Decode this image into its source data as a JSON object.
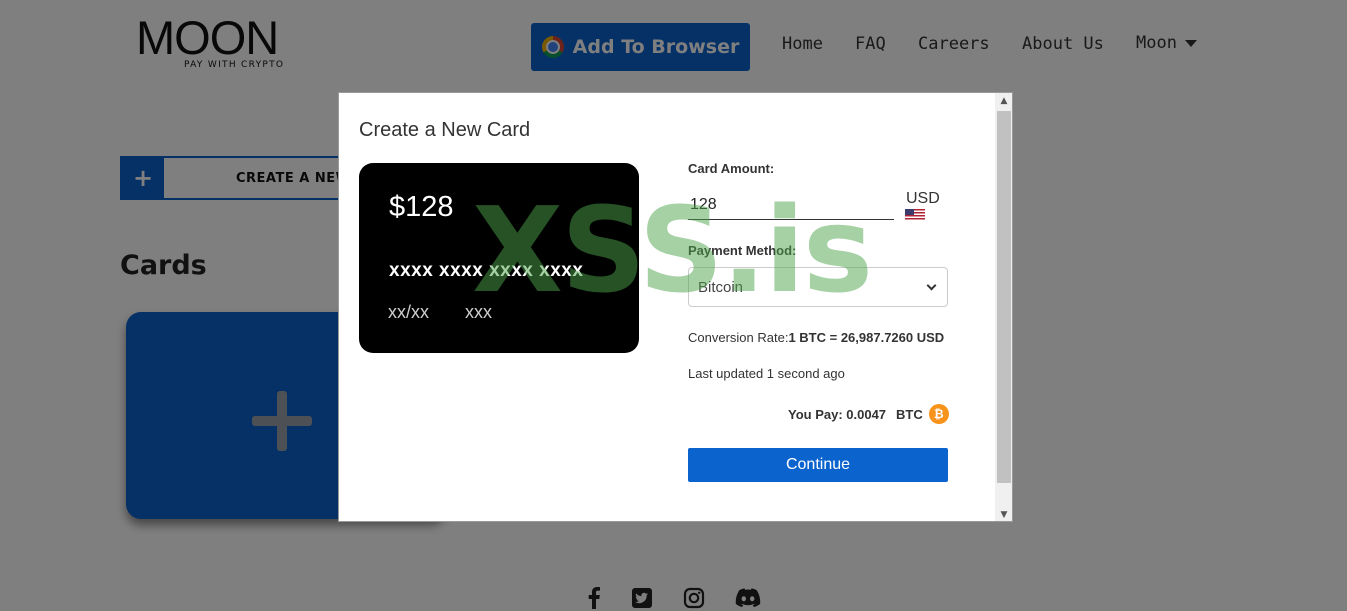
{
  "header": {
    "logo_text": "MOON",
    "logo_tagline": "PAY WITH CRYPTO",
    "add_to_browser_label": "Add To Browser",
    "nav": [
      {
        "label": "Home"
      },
      {
        "label": "FAQ"
      },
      {
        "label": "Careers"
      },
      {
        "label": "About Us"
      }
    ],
    "account_menu_label": "Moon"
  },
  "main": {
    "create_button_plus": "+",
    "create_button_label": "CREATE A NEW C",
    "cards_title": "Cards"
  },
  "footer": {
    "social_icons": [
      "facebook-icon",
      "twitter-icon",
      "instagram-icon",
      "discord-icon"
    ]
  },
  "modal": {
    "title": "Create a New Card",
    "card_preview": {
      "amount": "$128",
      "number": "xxxx xxxx xxxx xxxx",
      "expiry": "xx/xx",
      "cvv": "xxx"
    },
    "card_amount_label": "Card Amount:",
    "card_amount_value": "128",
    "currency": "USD",
    "payment_method_label": "Payment Method:",
    "payment_method_selected": "Bitcoin",
    "conversion_label": "Conversion Rate:",
    "conversion_value": "1 BTC = 26,987.7260 USD",
    "last_updated": "Last updated 1 second ago",
    "you_pay_label": "You Pay: 0.0047",
    "you_pay_currency": "BTC",
    "continue_label": "Continue"
  },
  "watermark": "XSS.is",
  "colors": {
    "accent": "#0b63ce",
    "bitcoin": "#f7931a",
    "watermark": "#4ca34c"
  }
}
